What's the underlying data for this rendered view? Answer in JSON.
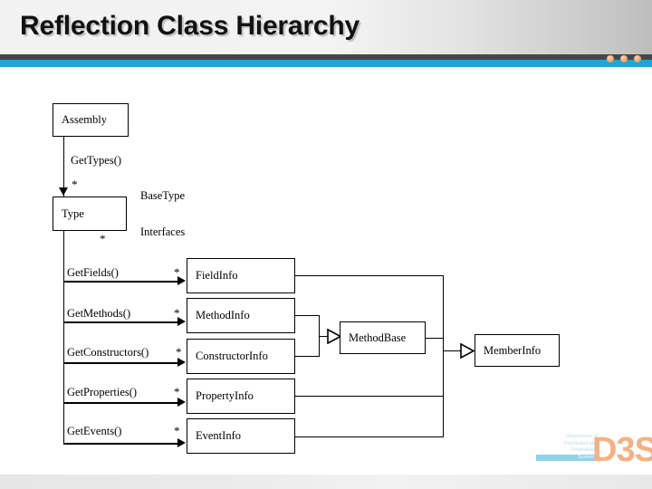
{
  "slide": {
    "title": "Reflection Class Hierarchy",
    "accent_color": "#20a5d6",
    "header_rule_color": "#474747",
    "dot_color": "#f0a86a"
  },
  "logo": {
    "line1": "Department of",
    "line2": "Distributed and",
    "line3": "Dependable",
    "line4": "Systems",
    "mark": "D3S",
    "mark_color": "#f5b183",
    "text_color": "#bcd9e8"
  },
  "diagram": {
    "nodes": [
      {
        "id": "assembly",
        "label": "Assembly"
      },
      {
        "id": "type",
        "label": "Type"
      },
      {
        "id": "fieldinfo",
        "label": "FieldInfo"
      },
      {
        "id": "methodinfo",
        "label": "MethodInfo"
      },
      {
        "id": "constructorinfo",
        "label": "ConstructorInfo"
      },
      {
        "id": "propertyinfo",
        "label": "PropertyInfo"
      },
      {
        "id": "eventinfo",
        "label": "EventInfo"
      },
      {
        "id": "methodbase",
        "label": "MethodBase"
      },
      {
        "id": "memberinfo",
        "label": "MemberInfo"
      }
    ],
    "edge_labels": [
      {
        "id": "gettypes",
        "text": "GetTypes()"
      },
      {
        "id": "basetype",
        "text": "BaseType"
      },
      {
        "id": "interfaces",
        "text": "Interfaces"
      },
      {
        "id": "getfields",
        "text": "GetFields()"
      },
      {
        "id": "getmethods",
        "text": "GetMethods()"
      },
      {
        "id": "getconstructors",
        "text": "GetConstructors()"
      },
      {
        "id": "getproperties",
        "text": "GetProperties()"
      },
      {
        "id": "getevents",
        "text": "GetEvents()"
      }
    ],
    "multiplicities": [
      {
        "id": "m-type",
        "text": "*"
      },
      {
        "id": "m-type-out",
        "text": "*"
      },
      {
        "id": "m-fieldinfo",
        "text": "*"
      },
      {
        "id": "m-methodinfo",
        "text": "*"
      },
      {
        "id": "m-constructorinfo",
        "text": "*"
      },
      {
        "id": "m-propertyinfo",
        "text": "*"
      },
      {
        "id": "m-eventinfo",
        "text": "*"
      }
    ]
  }
}
